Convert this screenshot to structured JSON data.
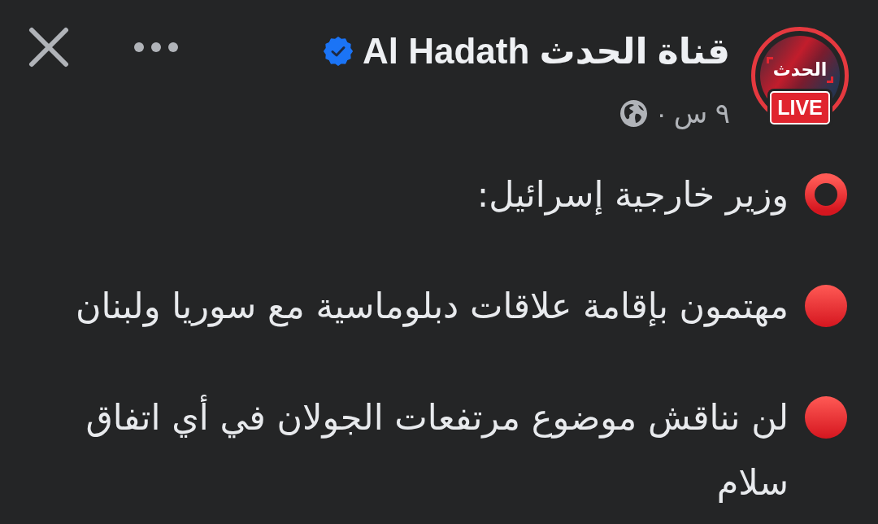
{
  "post_header": {
    "author": {
      "name": "قناة الحدث Al Hadath",
      "verified": true
    },
    "avatar": {
      "logo_text": "الحدث",
      "live_badge": "LIVE"
    },
    "timestamp": "٩ س ·"
  },
  "post_body": {
    "paragraphs": [
      {
        "kind": "ring",
        "text": "وزير خارجية إسرائيل:"
      },
      {
        "kind": "dot",
        "text": "مهتمون بإقامة علاقات دبلوماسية مع سوريا ولبنان"
      },
      {
        "kind": "dot",
        "text": "لن نناقش موضوع مرتفعات الجولان في أي اتفاق سلام"
      }
    ]
  }
}
